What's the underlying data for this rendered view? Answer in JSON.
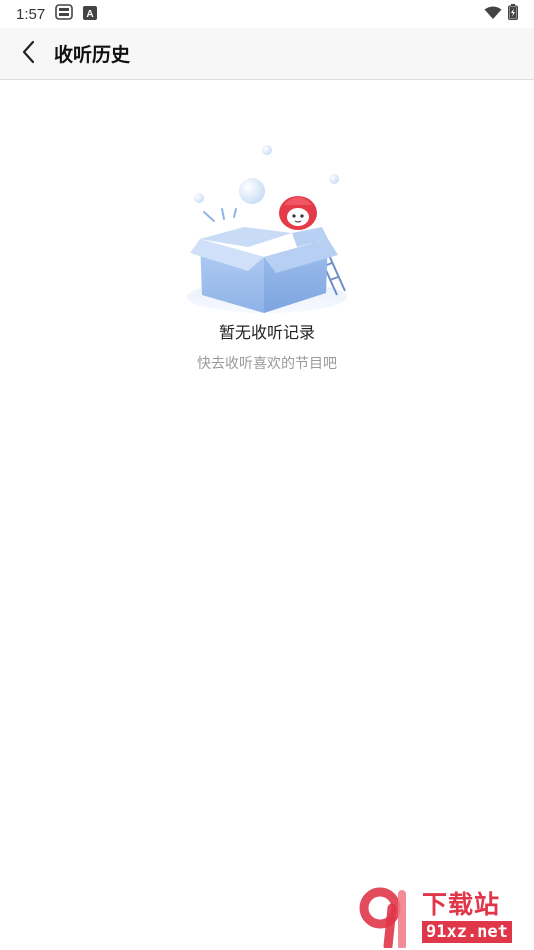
{
  "status_bar": {
    "time": "1:57",
    "icons": [
      "sim-card-icon",
      "keyboard-a-icon"
    ],
    "right_icons": [
      "wifi-icon",
      "battery-charging-icon"
    ]
  },
  "header": {
    "title": "收听历史",
    "back_icon": "chevron-left-icon"
  },
  "empty_state": {
    "illustration": "open-box-mascot-illustration",
    "title": "暂无收听记录",
    "subtitle": "快去收听喜欢的节目吧"
  },
  "watermark": {
    "brand": "下载站",
    "site": "91xz.net"
  },
  "colors": {
    "accent": "#e0364a",
    "box_blue": "#a9c6ef",
    "header_bg": "#f7f7f7"
  }
}
